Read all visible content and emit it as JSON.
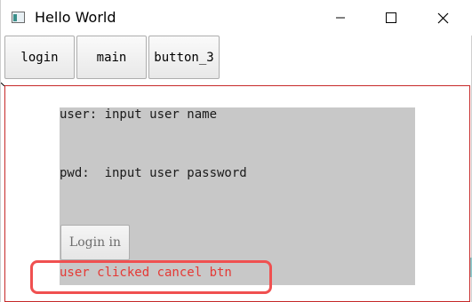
{
  "window": {
    "title": "Hello World",
    "controls": [
      "minimize-icon",
      "maximize-icon",
      "close-icon"
    ]
  },
  "toolbar": {
    "login_label": "login",
    "main_label": "main",
    "button3_label": "button_3"
  },
  "form": {
    "user_line": "user: input user name",
    "pwd_line": "pwd:  input user password",
    "login_button_label": "Login in"
  },
  "status": {
    "message": "user clicked cancel btn"
  },
  "colors": {
    "panel_bg": "#c8c8c8",
    "status_text": "#e53935",
    "content_border": "#c62828",
    "highlight": "#f05050"
  }
}
